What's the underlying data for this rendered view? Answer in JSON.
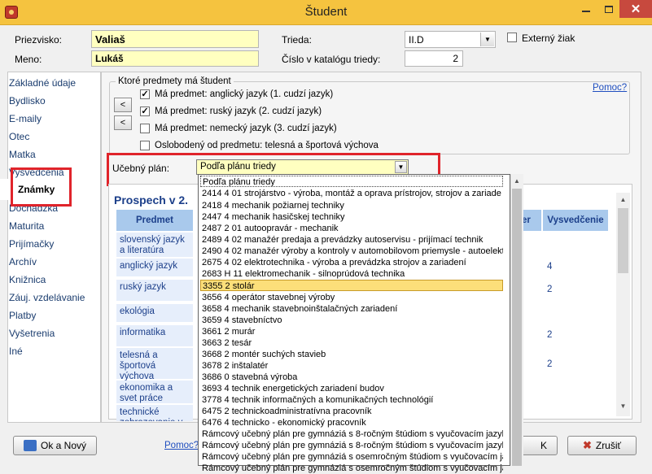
{
  "window": {
    "title": "Študent",
    "close_glyph": "✕"
  },
  "header": {
    "surname_label": "Priezvisko:",
    "surname_value": "Valiaš",
    "name_label": "Meno:",
    "name_value": "Lukáš",
    "class_label": "Trieda:",
    "class_value": "II.D",
    "catalog_label": "Číslo v katalógu triedy:",
    "catalog_value": "2",
    "external_label": "Externý žiak"
  },
  "sidebar": {
    "items": [
      "Základné údaje",
      "Bydlisko",
      "E-maily",
      "Otec",
      "Matka",
      "Vysvedčenia",
      "Známky",
      "Dochádzka",
      "Maturita",
      "Prijímačky",
      "Archív",
      "Knižnica",
      "Záuj. vzdelávanie",
      "Platby",
      "Vyšetrenia",
      "Iné"
    ],
    "active": "Známky"
  },
  "subjects": {
    "legend": "Ktoré predmety má študent",
    "help": "Pomoc?",
    "arrow_label": "<",
    "options": [
      {
        "label": "Má predmet: anglický jazyk (1. cudzí jazyk)",
        "checked": true
      },
      {
        "label": "Má predmet: ruský jazyk (2. cudzí jazyk)",
        "checked": true
      },
      {
        "label": "Má predmet: nemecký jazyk (3. cudzí jazyk)",
        "checked": false
      },
      {
        "label": "Oslobodený od predmetu: telesná a športová výchova",
        "checked": false
      }
    ]
  },
  "plan": {
    "label": "Učebný plán:",
    "value": "Podľa plánu triedy",
    "options": [
      "Podľa plánu triedy",
      "2414 4 01 strojárstvo - výroba, montáž a oprava prístrojov, strojov a zariade",
      "2418 4 mechanik požiarnej techniky",
      "2447 4 mechanik hasičskej techniky",
      "2487 2 01 autoopravár - mechanik",
      "2489 4 02 manažér predaja a prevádzky autoservisu - prijímací technik",
      "2490 4 02 manažér výroby a kontroly v automobilovom priemysle - autoelektr",
      "2675 4 02 elektrotechnika - výroba a prevádzka strojov a zariadení",
      "2683 H 11 elektromechanik - silnoprúdová technika",
      "3355 2 stolár",
      "3656 4 operátor stavebnej výroby",
      "3658 4 mechanik stavebnoinštalačných zariadení",
      "3659 4 stavebníctvo",
      "3661 2 murár",
      "3663 2 tesár",
      "3668 2 montér suchých stavieb",
      "3678 2 inštalatér",
      "3686 0 stavebná výroba",
      "3693 4 technik energetických zariadení budov",
      "3778 4 technik informačných a komunikačných technológií",
      "6475 2 technickoadministratívna pracovník",
      "6476 4 technicko - ekonomický pracovník",
      "Rámcový učebný plán pre gymnáziá s 8-ročným štúdiom s vyučovacím jazyk",
      "Rámcový učebný plán pre gymnáziá s 8-ročným štúdiom s vyučovacím jazyk",
      "Rámcový učebný plán pre gymnáziá s osemročným štúdiom s vyučovacím ja",
      "Rámcový učebný plán pre gymnáziá s osemročným štúdiom s vyučovacím ja"
    ],
    "selected_index": 9
  },
  "grades": {
    "title": "Prospech v 2.",
    "col_subject": "Predmet",
    "col_partial": "er",
    "col_report": "Vysvedčenie",
    "rows": [
      {
        "subject": "slovenský jazyk a literatúra",
        "grade": ""
      },
      {
        "subject": "anglický jazyk",
        "grade": "4"
      },
      {
        "subject": "ruský jazyk",
        "grade": "2"
      },
      {
        "subject": "ekológia",
        "grade": ""
      },
      {
        "subject": "informatika",
        "grade": "2"
      },
      {
        "subject": "telesná a športová výchova",
        "grade": "2"
      },
      {
        "subject": "ekonomika a svet práce",
        "grade": ""
      },
      {
        "subject": "technické zobrazovanie v",
        "grade": ""
      }
    ]
  },
  "footer": {
    "ok_new": "Ok a Nový",
    "help": "Pomoc?",
    "ok_trail": "K",
    "cancel": "Zrušiť"
  }
}
